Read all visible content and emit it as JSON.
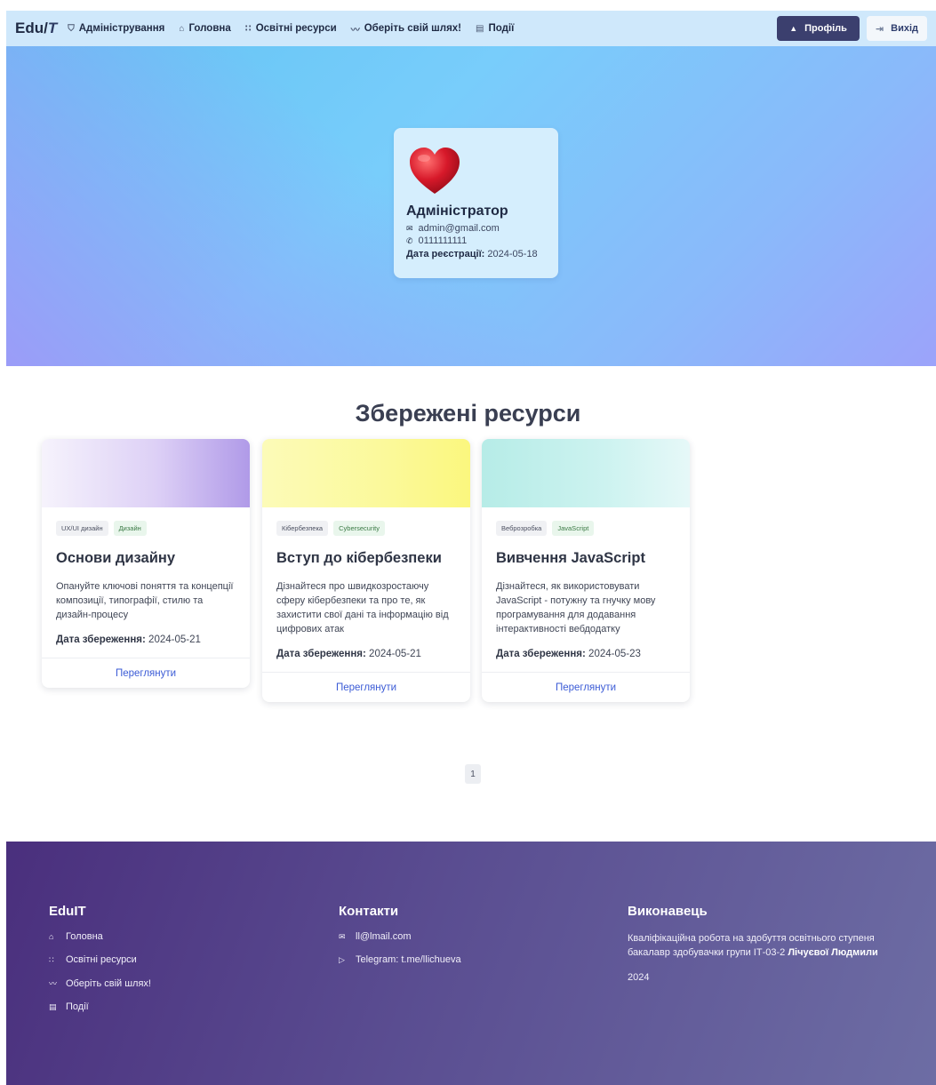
{
  "nav": {
    "brand_main": "Edu/",
    "brand_italic": "T",
    "links": [
      {
        "icon": "shield-icon",
        "glyph": "⛉",
        "label": "Адміністрування"
      },
      {
        "icon": "home-icon",
        "glyph": "⌂",
        "label": "Головна"
      },
      {
        "icon": "grid-icon",
        "glyph": "∷",
        "label": "Освітні ресурси"
      },
      {
        "icon": "trend-icon",
        "glyph": "〰",
        "label": "Оберіть свій шлях!"
      },
      {
        "icon": "events-icon",
        "glyph": "▤",
        "label": "Події"
      }
    ],
    "profile_label": "Профіль",
    "exit_label": "Вихід"
  },
  "profile": {
    "name": "Адміністратор",
    "email": "admin@gmail.com",
    "phone": "0111111111",
    "reg_label": "Дата реєстрації:",
    "reg_date": "2024-05-18"
  },
  "saved": {
    "title": "Збережені ресурси",
    "date_label": "Дата збереження:",
    "view_label": "Переглянути",
    "cards": [
      {
        "tags": [
          "UX/UI дизайн",
          "Дизайн"
        ],
        "title": "Основи дизайну",
        "desc": "Опануйте ключові поняття та концепції композиції, типографії, стилю та дизайн-процесу",
        "date": "2024-05-21",
        "accent": "#b8a3ec"
      },
      {
        "tags": [
          "Кібербезпека",
          "Cybersecurity"
        ],
        "title": "Вступ до кібербезпеки",
        "desc": "Дізнайтеся про швидкозростаючу сферу кібербезпеки та про те, як захистити свої дані та інформацію від цифрових атак",
        "date": "2024-05-21",
        "accent": "#fcf98d"
      },
      {
        "tags": [
          "Веброзробка",
          "JavaScript"
        ],
        "title": "Вивчення JavaScript",
        "desc": "Дізнайтеся, як використовувати JavaScript - потужну та гнучку мову програмування для додавання інтерактивності вебдодатку",
        "date": "2024-05-23",
        "accent": "#bff0ec"
      }
    ],
    "page": "1"
  },
  "footer": {
    "brand": "EduIT",
    "links": [
      "Головна",
      "Освітні ресурси",
      "Оберіть свій шлях!",
      "Події"
    ],
    "contacts_title": "Контакти",
    "email": "ll@lmail.com",
    "telegram": "Telegram: t.me/llichueva",
    "author_title": "Виконавець",
    "author_text": "Кваліфікаційна робота на здобуття освітнього ступеня бакалавр здобувачки групи ІТ-03-2",
    "author_name": "Лічуєвої Людмили",
    "year": "2024"
  }
}
